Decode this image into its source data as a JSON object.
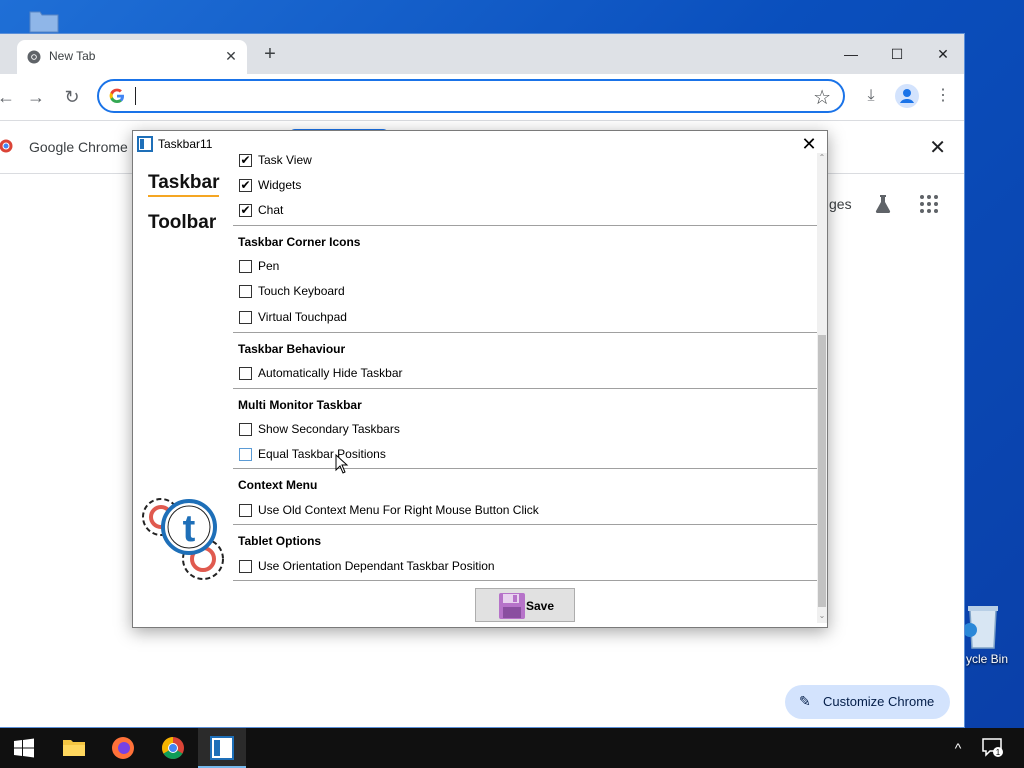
{
  "chrome": {
    "tab_title": "New Tab",
    "tab_close": "✕",
    "new_tab": "+",
    "minimize": "—",
    "maximize": "☐",
    "close": "✕",
    "back": "←",
    "forward": "→",
    "reload": "↻",
    "omnibox_value": "",
    "infobar_text": "Google Chrome is",
    "infobar_close": "✕",
    "ntp_link_partial": "ges",
    "customize_label": "Customize Chrome",
    "accent_color": "#1a73e8"
  },
  "desktop": {
    "recycle_bin_label": "ycle Bin"
  },
  "dialog": {
    "title": "Taskbar11",
    "close": "✕",
    "side_tabs": [
      "Taskbar",
      "Toolbar"
    ],
    "active_tab": "Taskbar",
    "options": [
      {
        "label": "Task View",
        "checked": true
      },
      {
        "label": "Widgets",
        "checked": true
      },
      {
        "label": "Chat",
        "checked": true
      }
    ],
    "sections": [
      {
        "title": "Taskbar Corner Icons",
        "items": [
          {
            "label": "Pen",
            "checked": false
          },
          {
            "label": "Touch Keyboard",
            "checked": false
          },
          {
            "label": "Virtual Touchpad",
            "checked": false
          }
        ]
      },
      {
        "title": "Taskbar Behaviour",
        "items": [
          {
            "label": "Automatically Hide Taskbar",
            "checked": false
          }
        ]
      },
      {
        "title": "Multi Monitor Taskbar",
        "items": [
          {
            "label": "Show Secondary Taskbars",
            "checked": false
          },
          {
            "label": "Equal Taskbar Positions",
            "checked": false
          }
        ]
      },
      {
        "title": "Context Menu",
        "items": [
          {
            "label": "Use Old Context Menu For Right Mouse Button Click",
            "checked": false
          }
        ]
      },
      {
        "title": "Tablet Options",
        "items": [
          {
            "label": "Use Orientation Dependant Taskbar Position",
            "checked": false
          }
        ]
      }
    ],
    "save_label": "Save",
    "checkmark": "✔",
    "brand_orange": "#f5a623"
  },
  "taskbar": {
    "items": [
      "start-button",
      "file-explorer",
      "firefox",
      "chrome",
      "taskbar11"
    ],
    "tray_chevron": "^",
    "notification_count": "1"
  }
}
